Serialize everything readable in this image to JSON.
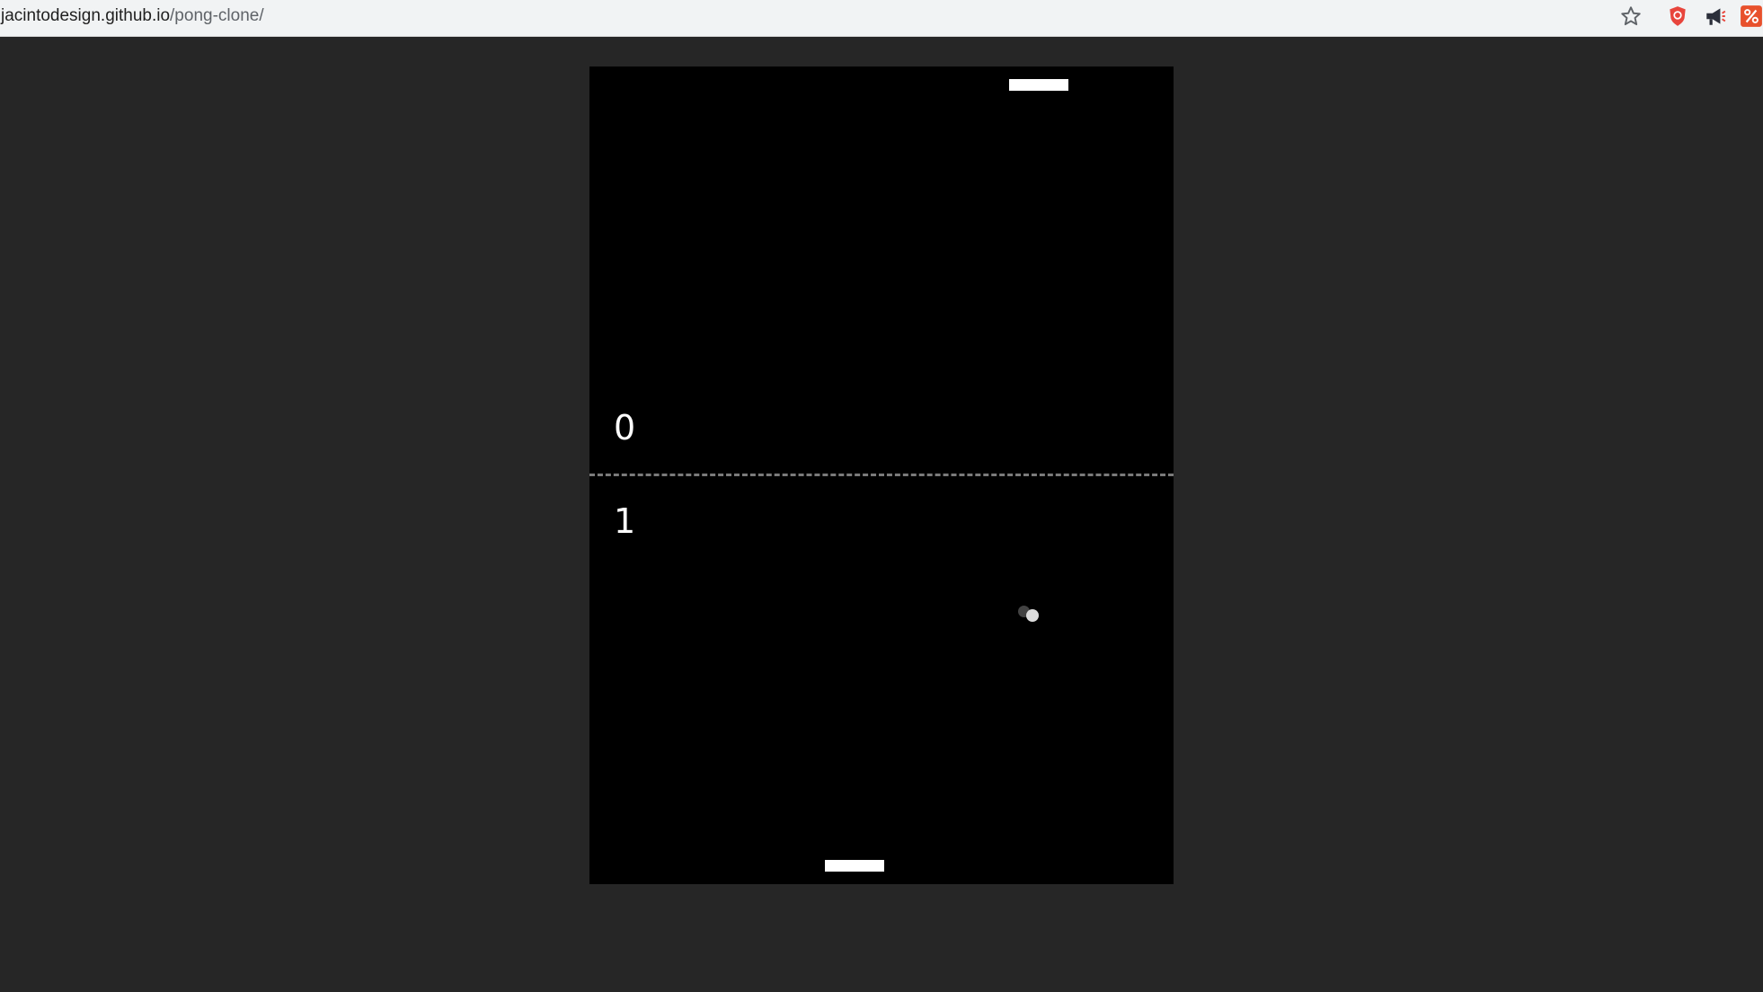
{
  "browser": {
    "url_host": "jacintodesign.github.io",
    "url_path": "/pong-clone/",
    "icons": [
      "star-icon",
      "shield-extension-icon",
      "megaphone-extension-icon",
      "percent-extension-icon"
    ]
  },
  "game": {
    "scores": {
      "top": "0",
      "bottom": "1"
    },
    "colors": {
      "page_background": "#262626",
      "board_background": "#000000",
      "score_text": "#ffffff",
      "paddle": "#ffffff",
      "ball": "#dddddd",
      "center_line": "#7a7a7a"
    }
  }
}
